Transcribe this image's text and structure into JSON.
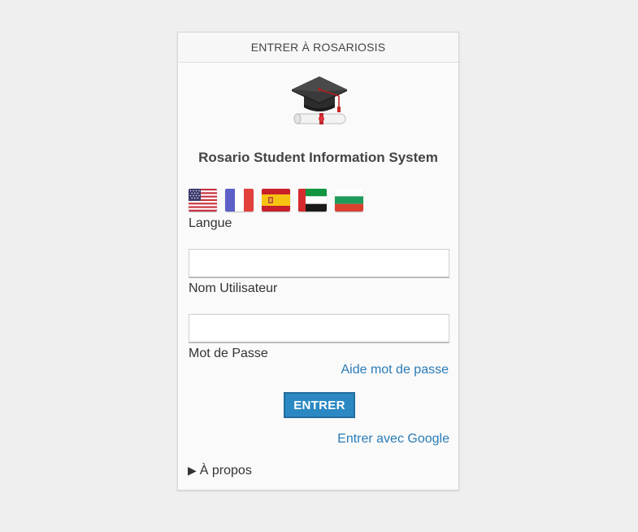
{
  "header": {
    "title": "ENTRER À ROSARIOSIS"
  },
  "system_title": "Rosario Student Information System",
  "languages": {
    "label": "Langue",
    "flags": [
      "us-flag-icon",
      "france-flag-icon",
      "spain-flag-icon",
      "uae-flag-icon",
      "bulgaria-flag-icon"
    ]
  },
  "username": {
    "label": "Nom Utilisateur",
    "value": ""
  },
  "password": {
    "label": "Mot de Passe",
    "value": ""
  },
  "password_help": "Aide mot de passe",
  "submit_label": "ENTRER",
  "google_login": "Entrer avec Google",
  "about": {
    "arrow": "▶",
    "label": "À propos"
  },
  "colors": {
    "accent": "#2b88c2",
    "link": "#2a7bb8",
    "background": "#efefef"
  }
}
